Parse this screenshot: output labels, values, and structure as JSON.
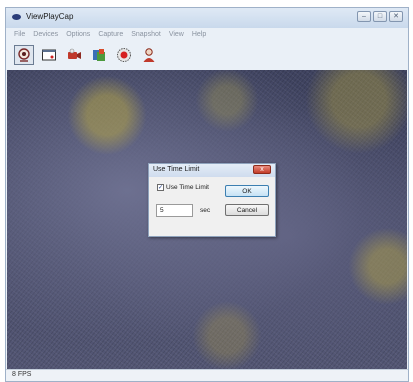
{
  "window": {
    "title": "ViewPlayCap",
    "app_icon": "eye-icon",
    "controls": {
      "minimize": "–",
      "maximize": "□",
      "close": "✕"
    }
  },
  "menu": [
    "File",
    "Devices",
    "Options",
    "Capture",
    "Snapshot",
    "View",
    "Help"
  ],
  "toolbar": {
    "buttons": [
      {
        "icon": "webcam-icon",
        "active": true
      },
      {
        "icon": "video-window-icon",
        "active": false
      },
      {
        "icon": "video-capture-icon",
        "active": false
      },
      {
        "icon": "color-adjust-icon",
        "active": false
      },
      {
        "icon": "record-icon",
        "active": false
      },
      {
        "icon": "user-snapshot-icon",
        "active": false
      }
    ]
  },
  "status": {
    "fps": "8 FPS"
  },
  "dialog": {
    "title": "Use Time Limit",
    "close_glyph": "x",
    "checkbox_label": "Use Time Limit",
    "checkbox_checked": true,
    "check_glyph": "✓",
    "time_value": "5",
    "unit": "sec",
    "ok_label": "OK",
    "cancel_label": "Cancel"
  },
  "colors": {
    "record_red": "#d62020",
    "window_frame": "#9fb1c8",
    "dialog_close": "#c33b28"
  }
}
